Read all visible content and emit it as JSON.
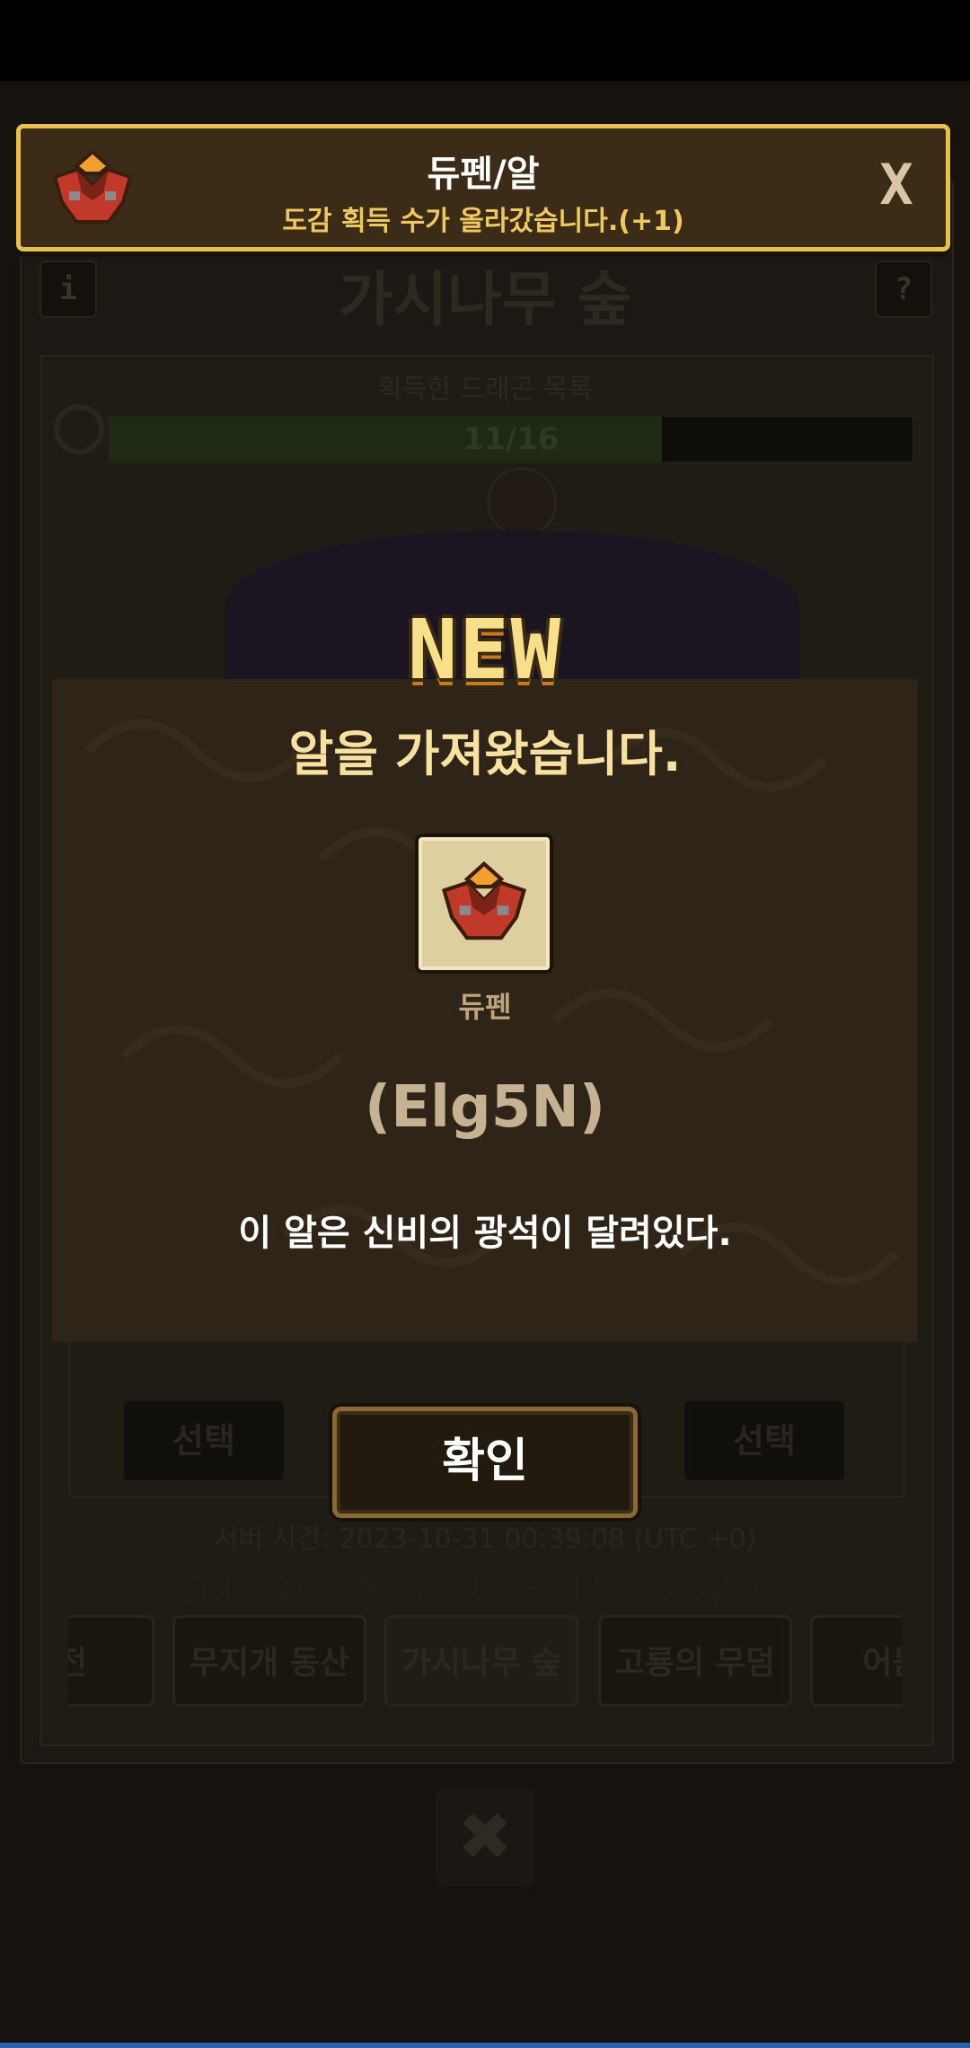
{
  "background": {
    "area_title": "가시나무 숲",
    "info_button": "i",
    "help_button": "?",
    "collection_label": "획득한 드래곤 목록",
    "collection_progress": {
      "current": 11,
      "total": 16,
      "text": "11/16"
    },
    "select_left": "선택",
    "select_right": "선택",
    "server_time": "서버 시간: 2023-10-31 00:39:08 (UTC +0)",
    "players_text": "전체 351명 중 176명이 함께 탐험 중입니다.",
    "tabs": [
      "신전",
      "무지개 동산",
      "가시나무 숲",
      "고룡의 무덤",
      "어둠의"
    ],
    "active_tab": "가시나무 숲",
    "close_label": "✖"
  },
  "notification": {
    "title": "듀펜/알",
    "subtitle": "도감 획득 수가 올라갔습니다.(+1)",
    "close_label": "X",
    "icon": "egg-icon"
  },
  "modal": {
    "badge": "NEW",
    "title": "알을 가져왔습니다.",
    "egg_name": "듀펜",
    "egg_code": "(Elg5N)",
    "description": "이 알은 신비의 광석이 달려있다.",
    "confirm_label": "확인"
  },
  "colors": {
    "accent_gold": "#e8c050",
    "modal_bg": "#2e2418",
    "egg_red": "#c0392b",
    "egg_orange": "#f0a030"
  }
}
